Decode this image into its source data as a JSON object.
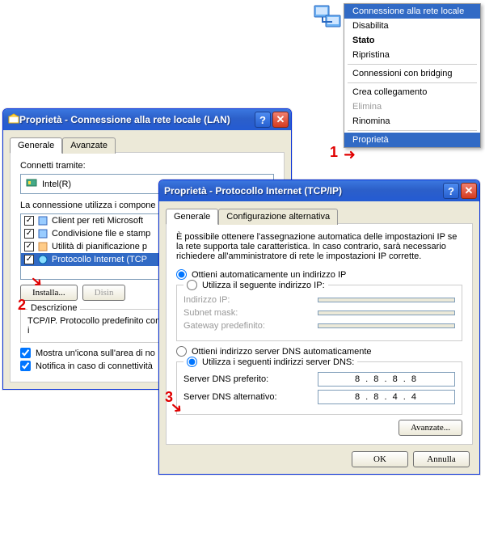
{
  "context_menu": {
    "header": "Connessione alla rete locale",
    "items": [
      {
        "label": "Disabilita",
        "disabled": false
      },
      {
        "label": "Stato",
        "bold": true
      },
      {
        "label": "Ripristina"
      }
    ],
    "items2": [
      {
        "label": "Connessioni con bridging"
      }
    ],
    "items3": [
      {
        "label": "Crea collegamento"
      },
      {
        "label": "Elimina",
        "disabled": true
      },
      {
        "label": "Rinomina"
      }
    ],
    "items4": [
      {
        "label": "Proprietà",
        "selected": true
      }
    ]
  },
  "annotations": {
    "n1": "1",
    "n2": "2",
    "n3": "3"
  },
  "win1": {
    "title": "Proprietà - Connessione alla rete locale (LAN)",
    "tabs": {
      "general": "Generale",
      "advanced": "Avanzate"
    },
    "connect_via": "Connetti tramite:",
    "adapter": "Intel(R)",
    "uses_components": "La connessione utilizza i compone",
    "components": [
      {
        "label": "Client per reti Microsoft"
      },
      {
        "label": "Condivisione file e stamp"
      },
      {
        "label": "Utilità di pianificazione p"
      },
      {
        "label": "Protocollo Internet (TCP",
        "selected": true
      }
    ],
    "buttons": {
      "install": "Installa...",
      "uninstall": "Disin"
    },
    "desc_label": "Descrizione",
    "desc_text": "TCP/IP. Protocollo predefinito comunicazione tra diverse reti i",
    "cb1": "Mostra un'icona sull'area di no",
    "cb2": "Notifica in caso di connettività"
  },
  "win2": {
    "title": "Proprietà - Protocollo Internet (TCP/IP)",
    "tabs": {
      "general": "Generale",
      "alt": "Configurazione alternativa"
    },
    "intro": "È possibile ottenere l'assegnazione automatica delle impostazioni IP se la rete supporta tale caratteristica. In caso contrario, sarà necessario richiedere all'amministratore di rete le impostazioni IP corrette.",
    "radio_auto_ip": "Ottieni automaticamente un indirizzo IP",
    "radio_manual_ip": "Utilizza il seguente indirizzo IP:",
    "ip_label": "Indirizzo IP:",
    "subnet_label": "Subnet mask:",
    "gateway_label": "Gateway predefinito:",
    "radio_auto_dns": "Ottieni indirizzo server DNS automaticamente",
    "radio_manual_dns": "Utilizza i seguenti indirizzi server DNS:",
    "dns1_label": "Server DNS preferito:",
    "dns2_label": "Server DNS alternativo:",
    "dns1": "8 . 8 . 8 . 8",
    "dns2": "8 . 8 . 4 . 4",
    "btn_advanced": "Avanzate...",
    "btn_ok": "OK",
    "btn_cancel": "Annulla"
  }
}
